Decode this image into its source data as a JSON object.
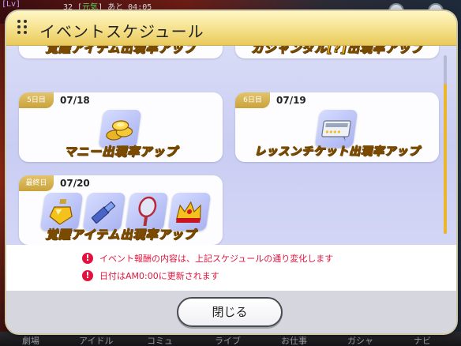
{
  "background": {
    "level_label": "[Lv]",
    "status_text": "32 [",
    "status_genki": "元気",
    "status_rest": "] あと 04:05",
    "bottom_tabs": [
      "劇場",
      "アイドル",
      "コミュ",
      "ライブ",
      "お仕事",
      "ガシャ",
      "ナビ"
    ]
  },
  "dialog": {
    "title": "イベントスケジュール",
    "partial_top_left": "覚醒アイテム出現率アップ",
    "partial_top_right": "ガシャンダル[?]出現率アップ",
    "cards": [
      {
        "day": "5日目",
        "date": "07/18",
        "effect": "マニー出現率アップ",
        "item": "money-coins-icon"
      },
      {
        "day": "6日目",
        "date": "07/19",
        "effect": "レッスンチケット出現率アップ",
        "item": "lesson-ticket-icon"
      },
      {
        "day": "最終日",
        "date": "07/20",
        "effect": "覚醒アイテム出現率アップ",
        "items": [
          "perfume-icon",
          "lipstick-icon",
          "hand-mirror-icon",
          "crown-icon"
        ]
      }
    ],
    "notes": [
      "イベント報酬の内容は、上記スケジュールの通り変化します",
      "日付はAM0:00に更新されます"
    ],
    "close_label": "閉じる"
  },
  "colors": {
    "header_gold": "#f5e08a",
    "badge_gold": "#c9a33b",
    "effect_text": "#f7c71c",
    "alert_red": "#e2123e",
    "panel_lavender": "#c9cdf2"
  }
}
